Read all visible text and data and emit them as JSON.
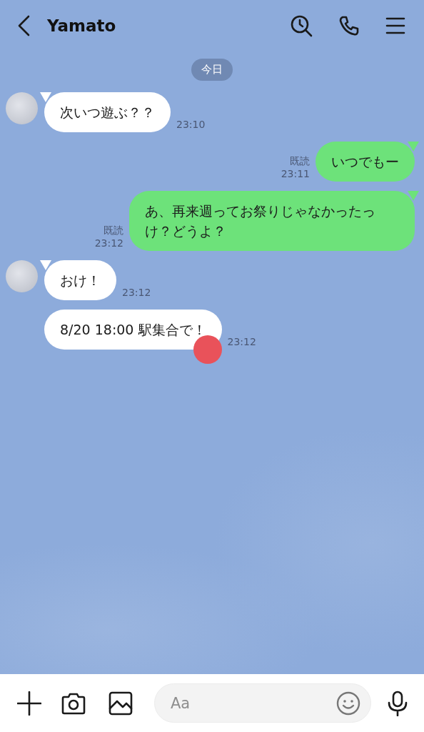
{
  "header": {
    "title": "Yamato"
  },
  "date_label": "今日",
  "messages": [
    {
      "kind": "received",
      "show_avatar": true,
      "text": "次いつ遊ぶ？？",
      "time": "23:10",
      "dot": false
    },
    {
      "kind": "sent",
      "read": "既読",
      "text": "いつでもー",
      "time": "23:11",
      "dot": false
    },
    {
      "kind": "sent",
      "read": "既読",
      "text": "あ、再来週ってお祭りじゃなかったっけ？どうよ？",
      "time": "23:12",
      "dot": false
    },
    {
      "kind": "received",
      "show_avatar": true,
      "text": "おけ！",
      "time": "23:12",
      "dot": false
    },
    {
      "kind": "received",
      "show_avatar": false,
      "text": "8/20 18:00 駅集合で！",
      "time": "23:12",
      "dot": true
    }
  ],
  "input": {
    "placeholder": "Aa"
  }
}
